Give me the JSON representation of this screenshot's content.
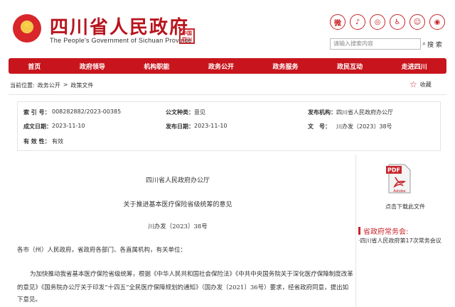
{
  "header": {
    "title": "四川省人民政府",
    "subtitle": "The People's Government of Sichuan Province",
    "seal_text": "中国四川",
    "icons": [
      "weibo-icon",
      "tiktok-icon",
      "wechat-icon",
      "accessibility-icon",
      "elderly-icon",
      "user-icon"
    ],
    "search_placeholder": "请输入搜索内容",
    "search_label": "搜 搜索"
  },
  "nav": {
    "items": [
      "首页",
      "政府领导",
      "机构职能",
      "政务公开",
      "政务服务",
      "政民互动",
      "走进四川"
    ]
  },
  "breadcrumb": {
    "prefix": "当前位置:",
    "items": [
      "政务公开",
      "政策文件"
    ],
    "sep": ">",
    "favorite_label": "收藏"
  },
  "info": {
    "index_label": "索 引 号：",
    "index_value": "008282882/2023-00385",
    "category_label": "公文种类：",
    "category_value": "意见",
    "issuer_label": "发布机构：",
    "issuer_value": "四川省人民政府办公厅",
    "created_label": "成文日期：",
    "created_value": "2023-11-10",
    "published_label": "发布日期：",
    "published_value": "2023-11-10",
    "docno_label": "文　号：",
    "docno_value": "川办发〔2023〕38号",
    "validity_label": "有 效 性：",
    "validity_value": "有效"
  },
  "document": {
    "org": "四川省人民政府办公厅",
    "title": "关于推进基本医疗保险省级统筹的意见",
    "number": "川办发〔2023〕38号",
    "salutation": "各市（州）人民政府，省政府各部门、各直属机构，有关单位：",
    "para1_line1": "为加快推动我省基本医疗保险省级统筹，根据《中华人民共和国社会保险法》《中共中央国务院关于深化医疗保障制度改革",
    "para1_line2": "的意见》《国务院办公厅关于印发“十四五”全民医疗保障规划的通知》（国办发〔2021〕36号）要求，经省政府同意，提出如",
    "para1_line3": "下意见。"
  },
  "sidebar": {
    "pdf_label": "点击下载此文件",
    "pdf_text": "PDF",
    "adobe_text": "Adobe",
    "section_title": "省政府常务会:",
    "section_item": "·四川省人民政府第17次常务会议"
  }
}
